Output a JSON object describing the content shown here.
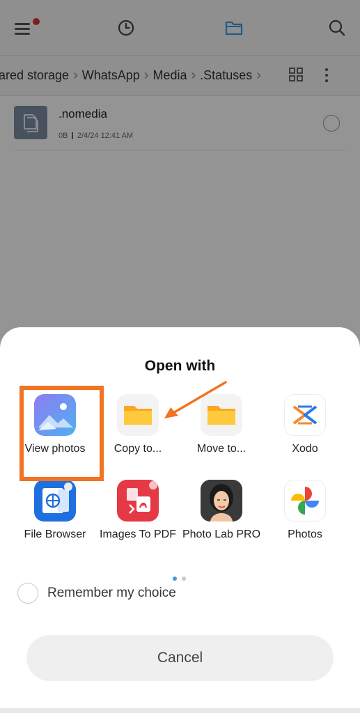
{
  "header": {
    "menu_icon": "hamburger-menu-icon",
    "history_icon": "clock-icon",
    "files_icon": "folder-icon",
    "search_icon": "search-icon",
    "notification_dot_color": "#e03030",
    "active_tab_color": "#3a9be8"
  },
  "breadcrumb": {
    "items": [
      "ıared storage",
      "WhatsApp",
      "Media",
      ".Statuses"
    ]
  },
  "file_list": {
    "items": [
      {
        "name": ".nomedia",
        "size": "0B",
        "date": "2/4/24 12:41 AM"
      }
    ]
  },
  "sheet": {
    "title": "Open with",
    "apps": [
      {
        "label": "View photos",
        "icon": "gallery-icon"
      },
      {
        "label": "Copy to...",
        "icon": "folder-icon"
      },
      {
        "label": "Move to...",
        "icon": "folder-icon"
      },
      {
        "label": "Xodo",
        "icon": "xodo-icon"
      },
      {
        "label": "File Browser",
        "icon": "file-browser-icon"
      },
      {
        "label": "Images To PDF",
        "icon": "pdf-icon"
      },
      {
        "label": "Photo Lab PRO",
        "icon": "photo-lab-icon"
      },
      {
        "label": "Photos",
        "icon": "google-photos-icon"
      }
    ],
    "pager": {
      "pages": 2,
      "current": 1
    },
    "remember_label": "Remember my choice",
    "cancel_label": "Cancel"
  },
  "annotation": {
    "highlight_color": "#f27321"
  }
}
